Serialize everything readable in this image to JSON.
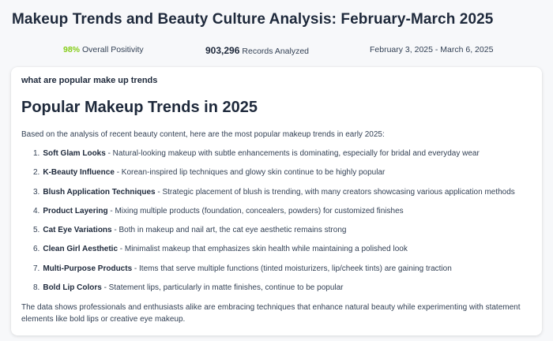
{
  "page": {
    "title": "Makeup Trends and Beauty Culture Analysis: February-March 2025"
  },
  "stats": {
    "positivity_value": "98%",
    "positivity_label": "Overall Positivity",
    "records_value": "903,296",
    "records_label": "Records Analyzed",
    "date_range": "February 3, 2025 - March 6, 2025"
  },
  "card": {
    "query": "what are popular make up trends",
    "heading": "Popular Makeup Trends in 2025",
    "intro": "Based on the analysis of recent beauty content, here are the most popular makeup trends in early 2025:",
    "trends": [
      {
        "num": "1.",
        "name": "Soft Glam Looks",
        "desc": " - Natural-looking makeup with subtle enhancements is dominating, especially for bridal and everyday wear"
      },
      {
        "num": "2.",
        "name": "K-Beauty Influence",
        "desc": " - Korean-inspired lip techniques and glowy skin continue to be highly popular"
      },
      {
        "num": "3.",
        "name": "Blush Application Techniques",
        "desc": " - Strategic placement of blush is trending, with many creators showcasing various application methods"
      },
      {
        "num": "4.",
        "name": "Product Layering",
        "desc": " - Mixing multiple products (foundation, concealers, powders) for customized finishes"
      },
      {
        "num": "5.",
        "name": "Cat Eye Variations",
        "desc": " - Both in makeup and nail art, the cat eye aesthetic remains strong"
      },
      {
        "num": "6.",
        "name": "Clean Girl Aesthetic",
        "desc": " - Minimalist makeup that emphasizes skin health while maintaining a polished look"
      },
      {
        "num": "7.",
        "name": "Multi-Purpose Products",
        "desc": " - Items that serve multiple functions (tinted moisturizers, lip/cheek tints) are gaining traction"
      },
      {
        "num": "8.",
        "name": "Bold Lip Colors",
        "desc": " - Statement lips, particularly in matte finishes, continue to be popular"
      }
    ],
    "outro": "The data shows professionals and enthusiasts alike are embracing techniques that enhance natural beauty while experimenting with statement elements like bold lips or creative eye makeup."
  },
  "colors": {
    "positivity": "#84cc16",
    "text": "#1e293b",
    "muted": "#334155",
    "background": "#f7f8fa",
    "card": "#ffffff"
  }
}
